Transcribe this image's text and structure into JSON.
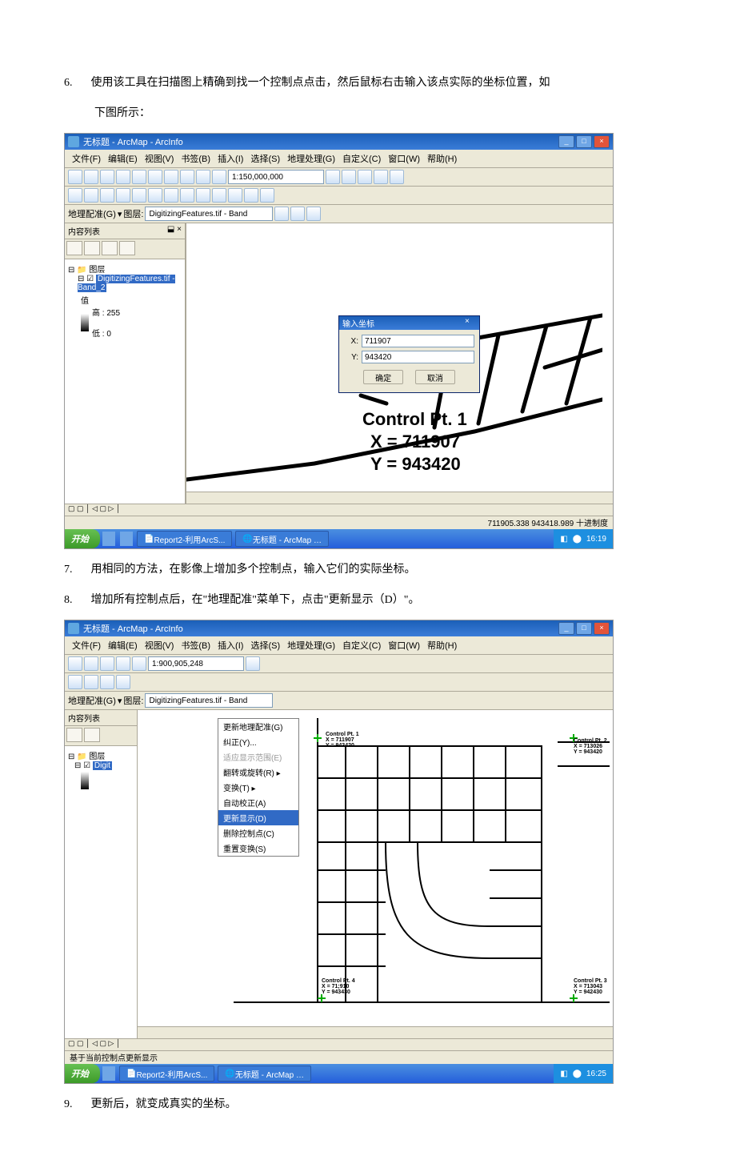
{
  "instructions": {
    "step6_num": "6.",
    "step6": "使用该工具在扫描图上精确到找一个控制点点击，然后鼠标右击输入该点实际的坐标位置，如",
    "step6b": "下图所示：",
    "step7_num": "7.",
    "step7": "用相同的方法，在影像上增加多个控制点，输入它们的实际坐标。",
    "step8_num": "8.",
    "step8": "增加所有控制点后，在\"地理配准\"菜单下，点击\"更新显示（D）\"。",
    "step9_num": "9.",
    "step9": "更新后，就变成真实的坐标。"
  },
  "app": {
    "title": "无标题 - ArcMap - ArcInfo",
    "menu": [
      "文件(F)",
      "编辑(E)",
      "视图(V)",
      "书签(B)",
      "插入(I)",
      "选择(S)",
      "地理处理(G)",
      "自定义(C)",
      "窗口(W)",
      "帮助(H)"
    ],
    "scale1": "1:150,000,000",
    "scale2": "1:900,905,248",
    "georef": "地理配准(G)",
    "layer": "图层:",
    "layerfile": "DigitizingFeatures.tif - Band",
    "toc": "内容列表",
    "layers": "图层",
    "layer_item": "DigitizingFeatures.tif - Band_2",
    "val": "值",
    "high": "高 : 255",
    "low": "低 : 0",
    "dlg_title": "输入坐标",
    "x_lbl": "X:",
    "y_lbl": "Y:",
    "x_val": "711907",
    "y_val": "943420",
    "ok": "确定",
    "cancel": "取消",
    "ctrl_pt": "Control Pt. 1",
    "xline": "X = 711907",
    "yline": "Y = 943420",
    "status1": "711905.338  943418.989 十进制度",
    "status2": "基于当前控制点更新显示"
  },
  "ctxmenu": [
    "更新地理配准(G)",
    "纠正(Y)...",
    "适应显示范围(E)",
    "翻转或旋转(R)",
    "变换(T)",
    "自动校正(A)",
    "更新显示(D)",
    "删除控制点(C)",
    "重置变换(S)"
  ],
  "cp": {
    "cp1": "Control Pt. 1",
    "cp1x": "X = 711907",
    "cp1y": "Y = 943420",
    "cp2": "Control Pt. 2",
    "cp2x": "X = 713026",
    "cp2y": "Y = 943420",
    "cp3": "Control Pt. 3",
    "cp3x": "X = 713043",
    "cp3y": "Y = 942430",
    "cp4": "Control Pt. 4",
    "cp4x": "X = 71;910",
    "cp4y": "Y = 943430"
  },
  "taskbar": {
    "start": "开始",
    "item1": "Report2-利用ArcS...",
    "item2": "无标题 - ArcMap …",
    "time1": "16:19",
    "time2": "16:25"
  }
}
